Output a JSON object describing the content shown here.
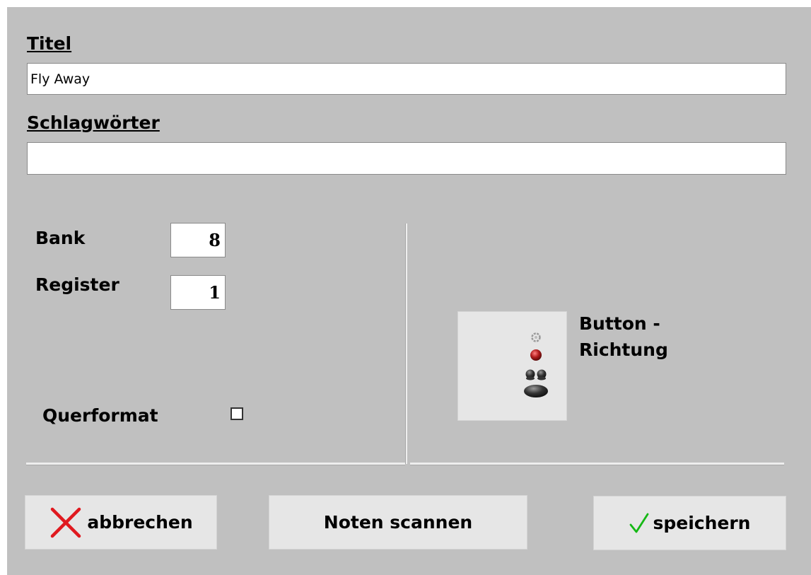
{
  "form": {
    "title_label": "Titel",
    "title_value": "Fly Away",
    "keywords_label": "Schlagwörter",
    "keywords_value": "",
    "bank_label": "Bank",
    "bank_value": "8",
    "register_label": "Register",
    "register_value": "1",
    "landscape_label": "Querformat",
    "landscape_checked": false,
    "direction_button_label_line1": "Button -",
    "direction_button_label_line2": "Richtung",
    "direction_icon": "traffic-light-icon"
  },
  "buttons": {
    "cancel_label": "abbrechen",
    "cancel_icon": "red-x-icon",
    "scan_label": "Noten scannen",
    "save_label": "speichern",
    "save_icon": "green-check-icon"
  },
  "colors": {
    "dialog_background": "#c0c0c0",
    "button_background": "#e6e6e6",
    "cancel_icon_color": "#e0191f",
    "save_icon_color": "#15b815",
    "light_red": "#b01c1c"
  }
}
